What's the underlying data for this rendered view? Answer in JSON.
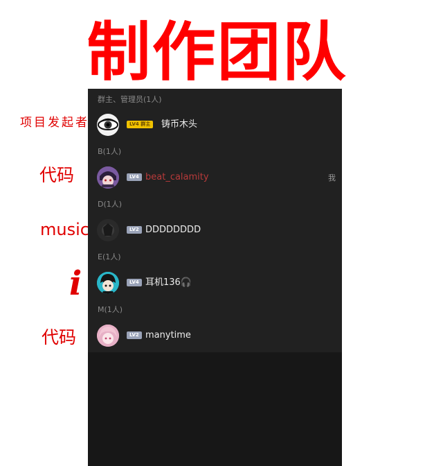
{
  "banner": {
    "title": "制作团队",
    "color": "#ff0000"
  },
  "annotations": {
    "a1": "项目发起者",
    "a2": "代码",
    "a3": "music",
    "a4": "i",
    "a5": "代码"
  },
  "sections": [
    {
      "header": "群主、管理员(1人)",
      "member": {
        "level": "LV4",
        "role": "群主",
        "name": "铸币木头",
        "avatar": "eye-avatar"
      }
    },
    {
      "header": "B(1人)",
      "member": {
        "level": "LV4",
        "name": "beat_calamity",
        "tag": "我",
        "avatar": "anime-avatar-purple",
        "name_color": "#b83a3a"
      }
    },
    {
      "header": "D(1人)",
      "member": {
        "level": "LV2",
        "name": "DDDDDDDD",
        "avatar": "dark-avatar"
      }
    },
    {
      "header": "E(1人)",
      "member": {
        "level": "LV4",
        "name": "耳机136🎧",
        "avatar": "anime-avatar-teal"
      }
    },
    {
      "header": "M(1人)",
      "member": {
        "level": "LV2",
        "name": "manytime",
        "avatar": "anime-avatar-pink"
      }
    }
  ]
}
